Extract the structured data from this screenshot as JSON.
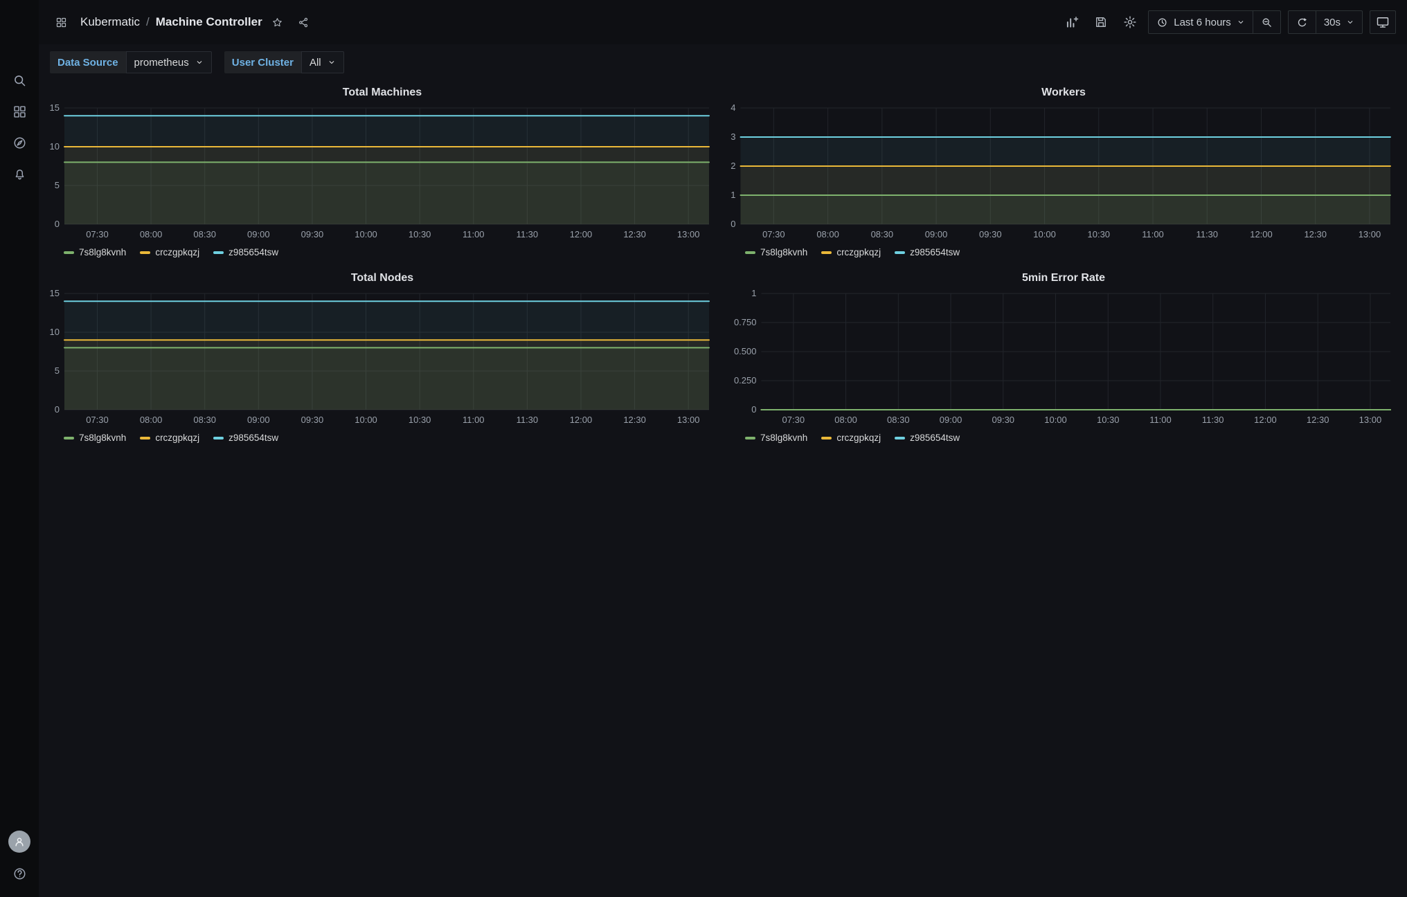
{
  "sidebar": {
    "items": [
      {
        "id": "search",
        "icon": "search-icon"
      },
      {
        "id": "dashboards",
        "icon": "apps-grid-icon"
      },
      {
        "id": "explore",
        "icon": "compass-icon"
      },
      {
        "id": "alerting",
        "icon": "bell-icon"
      }
    ],
    "bottom": [
      {
        "id": "profile",
        "icon": "user-avatar-icon"
      },
      {
        "id": "help",
        "icon": "question-circle-icon"
      }
    ]
  },
  "header": {
    "breadcrumb": {
      "root": "Kubermatic",
      "separator": "/",
      "current": "Machine Controller"
    },
    "time_range": "Last 6 hours",
    "refresh_interval": "30s",
    "icons": [
      "apps-grid-icon",
      "star-icon",
      "share-icon",
      "add-panel-icon",
      "save-icon",
      "gear-icon",
      "clock-icon",
      "chevron-down-icon",
      "zoom-out-icon",
      "refresh-icon",
      "monitor-icon"
    ]
  },
  "submenu": {
    "data_source": {
      "label": "Data Source",
      "value": "prometheus"
    },
    "user_cluster": {
      "label": "User Cluster",
      "value": "All"
    }
  },
  "palette": {
    "green": "#7EB26D",
    "yellow": "#EAB839",
    "cyan": "#6ED0E0",
    "accent_blue": "#6fb2e4"
  },
  "chart_data": [
    {
      "type": "line",
      "title": "Total Machines",
      "x": [
        "07:30",
        "08:00",
        "08:30",
        "09:00",
        "09:30",
        "10:00",
        "10:30",
        "11:00",
        "11:30",
        "12:00",
        "12:30",
        "13:00"
      ],
      "ylim": [
        0,
        15
      ],
      "y_ticks": [
        "0",
        "5",
        "10",
        "15"
      ],
      "grid": true,
      "legend_position": "bottom",
      "series": [
        {
          "name": "7s8lg8kvnh",
          "color": "#7EB26D",
          "value": 8
        },
        {
          "name": "crczgpkqzj",
          "color": "#EAB839",
          "value": 10
        },
        {
          "name": "z985654tsw",
          "color": "#6ED0E0",
          "value": 14
        }
      ]
    },
    {
      "type": "line",
      "title": "Workers",
      "x": [
        "07:30",
        "08:00",
        "08:30",
        "09:00",
        "09:30",
        "10:00",
        "10:30",
        "11:00",
        "11:30",
        "12:00",
        "12:30",
        "13:00"
      ],
      "ylim": [
        0,
        4
      ],
      "y_ticks": [
        "0",
        "1",
        "2",
        "3",
        "4"
      ],
      "grid": true,
      "legend_position": "bottom",
      "series": [
        {
          "name": "7s8lg8kvnh",
          "color": "#7EB26D",
          "value": 1
        },
        {
          "name": "crczgpkqzj",
          "color": "#EAB839",
          "value": 2
        },
        {
          "name": "z985654tsw",
          "color": "#6ED0E0",
          "value": 3
        }
      ]
    },
    {
      "type": "line",
      "title": "Total Nodes",
      "x": [
        "07:30",
        "08:00",
        "08:30",
        "09:00",
        "09:30",
        "10:00",
        "10:30",
        "11:00",
        "11:30",
        "12:00",
        "12:30",
        "13:00"
      ],
      "ylim": [
        0,
        15
      ],
      "y_ticks": [
        "0",
        "5",
        "10",
        "15"
      ],
      "grid": true,
      "legend_position": "bottom",
      "series": [
        {
          "name": "7s8lg8kvnh",
          "color": "#7EB26D",
          "value": 8
        },
        {
          "name": "crczgpkqzj",
          "color": "#EAB839",
          "value": 9
        },
        {
          "name": "z985654tsw",
          "color": "#6ED0E0",
          "value": 14
        }
      ]
    },
    {
      "type": "line",
      "title": "5min Error Rate",
      "x": [
        "07:30",
        "08:00",
        "08:30",
        "09:00",
        "09:30",
        "10:00",
        "10:30",
        "11:00",
        "11:30",
        "12:00",
        "12:30",
        "13:00"
      ],
      "ylim": [
        0,
        1
      ],
      "y_ticks": [
        "0",
        "0.250",
        "0.500",
        "0.750",
        "1"
      ],
      "grid": true,
      "legend_position": "bottom",
      "series": [
        {
          "name": "7s8lg8kvnh",
          "color": "#7EB26D",
          "value": 0
        },
        {
          "name": "crczgpkqzj",
          "color": "#EAB839",
          "value": 0
        },
        {
          "name": "z985654tsw",
          "color": "#6ED0E0",
          "value": 0
        }
      ]
    }
  ]
}
